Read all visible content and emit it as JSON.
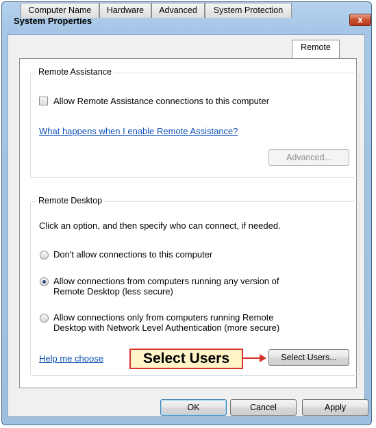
{
  "window": {
    "title": "System Properties",
    "close_label": "x"
  },
  "tabs": [
    {
      "label": "Computer Name"
    },
    {
      "label": "Hardware"
    },
    {
      "label": "Advanced"
    },
    {
      "label": "System Protection"
    },
    {
      "label": "Remote",
      "active": true
    }
  ],
  "remote_assistance": {
    "group_label": "Remote Assistance",
    "checkbox_label": "Allow Remote Assistance connections to this computer",
    "checkbox_checked": false,
    "help_link": "What happens when I enable Remote Assistance?",
    "advanced_button": "Advanced..."
  },
  "remote_desktop": {
    "group_label": "Remote Desktop",
    "instruction": "Click an option, and then specify who can connect, if needed.",
    "options": [
      {
        "label": "Don't allow connections to this computer",
        "selected": false
      },
      {
        "label_line1": "Allow connections from computers running any version of",
        "label_line2": "Remote Desktop (less secure)",
        "selected": true
      },
      {
        "label_line1": "Allow connections only from computers running Remote",
        "label_line2": "Desktop with Network Level Authentication (more secure)",
        "selected": false
      }
    ],
    "help_link": "Help me choose",
    "select_users_button": "Select Users..."
  },
  "callout": {
    "text": "Select Users",
    "color": "#d9322c"
  },
  "footer": {
    "ok": "OK",
    "cancel": "Cancel",
    "apply": "Apply"
  }
}
